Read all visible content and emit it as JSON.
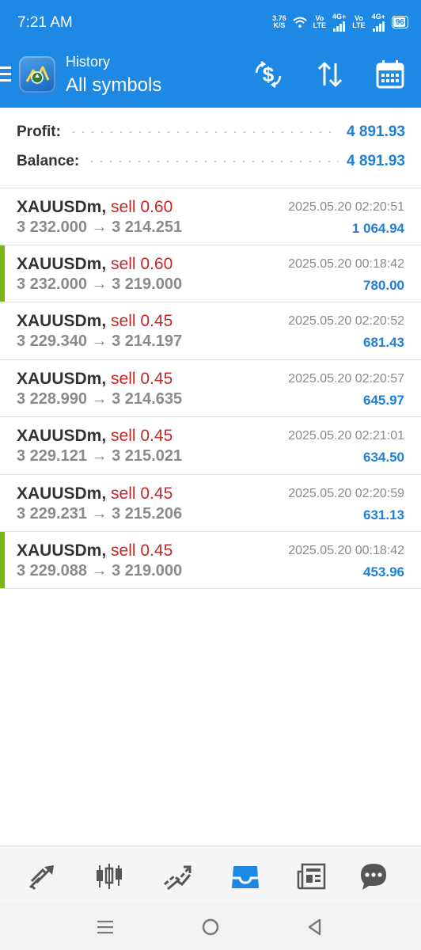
{
  "status_bar": {
    "time": "7:21 AM",
    "speed_value": "3.76",
    "speed_unit": "K/S",
    "volte1_top": "Vo",
    "volte1_bottom": "LTE",
    "net1": "4G+",
    "volte2_top": "Vo",
    "volte2_bottom": "LTE",
    "net2": "4G+",
    "battery": "96"
  },
  "header": {
    "title": "History",
    "subtitle": "All symbols",
    "icons": [
      "menu-icon",
      "metatrader-logo",
      "deposit-withdraw-icon",
      "sort-icon",
      "calendar-icon"
    ]
  },
  "summary": {
    "profit_label": "Profit:",
    "profit_value": "4 891.93",
    "balance_label": "Balance:",
    "balance_value": "4 891.93"
  },
  "trades": [
    {
      "symbol": "XAUUSDm",
      "side": "sell 0.60",
      "prices": "3 232.000 → 3 214.251",
      "time": "2025.05.20 02:20:51",
      "profit": "1 064.94",
      "marked": false
    },
    {
      "symbol": "XAUUSDm",
      "side": "sell 0.60",
      "prices": "3 232.000 → 3 219.000",
      "time": "2025.05.20 00:18:42",
      "profit": "780.00",
      "marked": true
    },
    {
      "symbol": "XAUUSDm",
      "side": "sell 0.45",
      "prices": "3 229.340 → 3 214.197",
      "time": "2025.05.20 02:20:52",
      "profit": "681.43",
      "marked": false
    },
    {
      "symbol": "XAUUSDm",
      "side": "sell 0.45",
      "prices": "3 228.990 → 3 214.635",
      "time": "2025.05.20 02:20:57",
      "profit": "645.97",
      "marked": false
    },
    {
      "symbol": "XAUUSDm",
      "side": "sell 0.45",
      "prices": "3 229.121 → 3 215.021",
      "time": "2025.05.20 02:21:01",
      "profit": "634.50",
      "marked": false
    },
    {
      "symbol": "XAUUSDm",
      "side": "sell 0.45",
      "prices": "3 229.231 → 3 215.206",
      "time": "2025.05.20 02:20:59",
      "profit": "631.13",
      "marked": false
    },
    {
      "symbol": "XAUUSDm",
      "side": "sell 0.45",
      "prices": "3 229.088 → 3 219.000",
      "time": "2025.05.20 00:18:42",
      "profit": "453.96",
      "marked": true
    }
  ],
  "bottom_nav": {
    "items": [
      "quotes-icon",
      "chart-icon",
      "trade-icon",
      "history-icon",
      "news-icon",
      "chat-icon"
    ],
    "active": "history-icon"
  },
  "colors": {
    "header_bg": "#1e88e5",
    "profit_blue": "#1e7fd9",
    "sell_red": "#c62828",
    "marker_green": "#7cb518",
    "nav_active": "#1e88e5",
    "nav_icon": "#555555"
  }
}
